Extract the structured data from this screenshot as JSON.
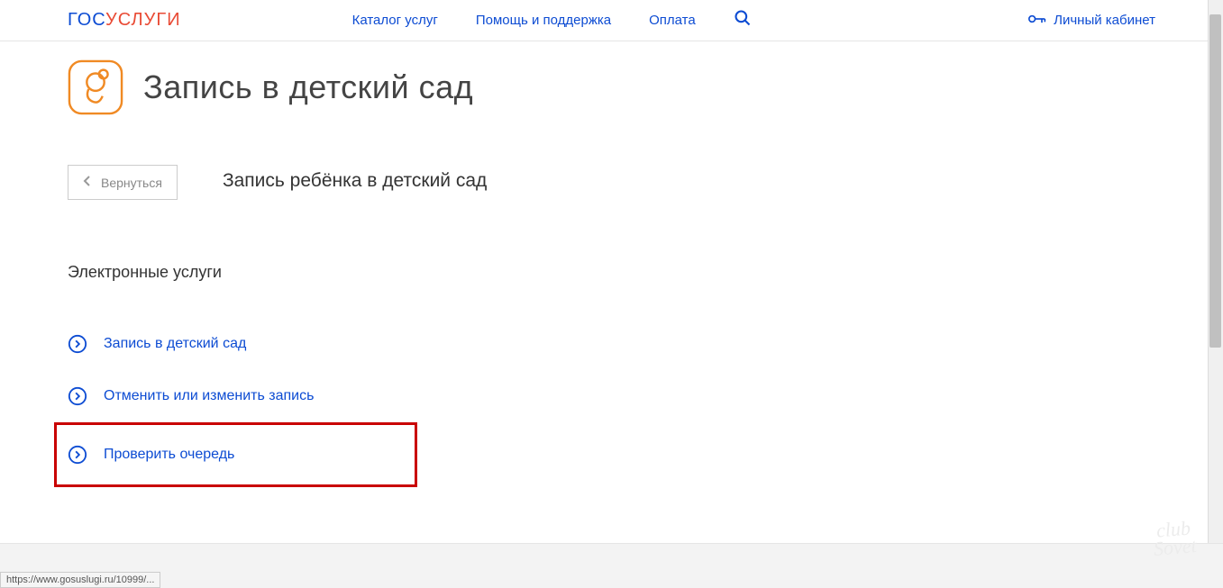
{
  "header": {
    "logo_part1": "гос",
    "logo_part2": "услуги",
    "nav": {
      "catalog": "Каталог услуг",
      "help": "Помощь и поддержка",
      "payment": "Оплата"
    },
    "account": "Личный кабинет"
  },
  "page": {
    "title": "Запись в детский сад",
    "back": "Вернуться",
    "subtitle": "Запись ребёнка в детский сад",
    "section_label": "Электронные услуги",
    "services": {
      "enroll": "Запись в детский сад",
      "cancel": "Отменить или изменить запись",
      "check": "Проверить очередь"
    }
  },
  "watermark": {
    "line1": "club",
    "line2": "Sovet"
  },
  "status": "https://www.gosuslugi.ru/10999/..."
}
